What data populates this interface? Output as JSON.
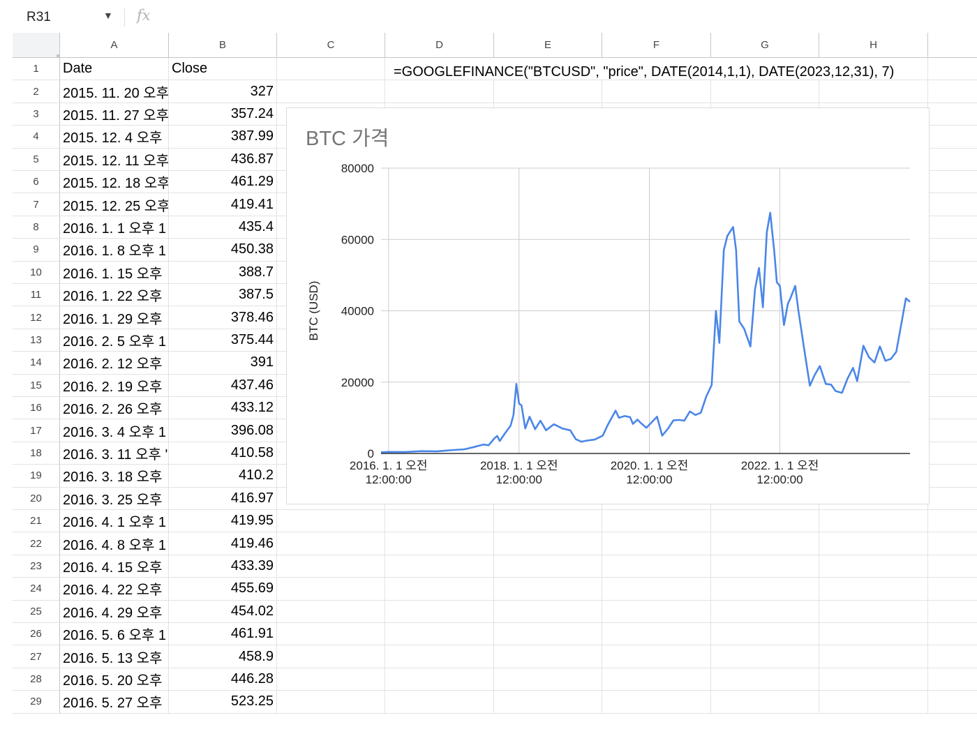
{
  "formula_bar": {
    "cell_ref": "R31",
    "fx_label": "fx"
  },
  "columns": [
    "A",
    "B",
    "C",
    "D",
    "E",
    "F",
    "G",
    "H"
  ],
  "rows": [
    {
      "num": "1",
      "date": "Date",
      "close": "Close"
    },
    {
      "num": "2",
      "date": "2015. 11. 20 오후",
      "close": "327"
    },
    {
      "num": "3",
      "date": "2015. 11. 27 오후",
      "close": "357.24"
    },
    {
      "num": "4",
      "date": "2015. 12. 4 오후",
      "close": "387.99"
    },
    {
      "num": "5",
      "date": "2015. 12. 11 오후",
      "close": "436.87"
    },
    {
      "num": "6",
      "date": "2015. 12. 18 오후",
      "close": "461.29"
    },
    {
      "num": "7",
      "date": "2015. 12. 25 오후",
      "close": "419.41"
    },
    {
      "num": "8",
      "date": "2016. 1. 1 오후 1",
      "close": "435.4"
    },
    {
      "num": "9",
      "date": "2016. 1. 8 오후 1",
      "close": "450.38"
    },
    {
      "num": "10",
      "date": "2016. 1. 15 오후",
      "close": "388.7"
    },
    {
      "num": "11",
      "date": "2016. 1. 22 오후",
      "close": "387.5"
    },
    {
      "num": "12",
      "date": "2016. 1. 29 오후",
      "close": "378.46"
    },
    {
      "num": "13",
      "date": "2016. 2. 5 오후 1",
      "close": "375.44"
    },
    {
      "num": "14",
      "date": "2016. 2. 12 오후",
      "close": "391"
    },
    {
      "num": "15",
      "date": "2016. 2. 19 오후",
      "close": "437.46"
    },
    {
      "num": "16",
      "date": "2016. 2. 26 오후",
      "close": "433.12"
    },
    {
      "num": "17",
      "date": "2016. 3. 4 오후 1",
      "close": "396.08"
    },
    {
      "num": "18",
      "date": "2016. 3. 11 오후 '",
      "close": "410.58"
    },
    {
      "num": "19",
      "date": "2016. 3. 18 오후",
      "close": "410.2"
    },
    {
      "num": "20",
      "date": "2016. 3. 25 오후",
      "close": "416.97"
    },
    {
      "num": "21",
      "date": "2016. 4. 1 오후 1",
      "close": "419.95"
    },
    {
      "num": "22",
      "date": "2016. 4. 8 오후 1",
      "close": "419.46"
    },
    {
      "num": "23",
      "date": "2016. 4. 15 오후",
      "close": "433.39"
    },
    {
      "num": "24",
      "date": "2016. 4. 22 오후",
      "close": "455.69"
    },
    {
      "num": "25",
      "date": "2016. 4. 29 오후",
      "close": "454.02"
    },
    {
      "num": "26",
      "date": "2016. 5. 6 오후 1",
      "close": "461.91"
    },
    {
      "num": "27",
      "date": "2016. 5. 13 오후",
      "close": "458.9"
    },
    {
      "num": "28",
      "date": "2016. 5. 20 오후",
      "close": "446.28"
    },
    {
      "num": "29",
      "date": "2016. 5. 27 오후",
      "close": "523.25"
    }
  ],
  "formula_cell": {
    "ref": "D1",
    "text": "=GOOGLEFINANCE(\"BTCUSD\", \"price\", DATE(2014,1,1), DATE(2023,12,31), 7)"
  },
  "chart_data": {
    "type": "line",
    "title": "BTC 가격",
    "xlabel": "",
    "ylabel": "BTC (USD)",
    "ylim": [
      0,
      80000
    ],
    "y_ticks": [
      "80000",
      "60000",
      "40000",
      "20000",
      "0"
    ],
    "x_ticks": [
      {
        "line1": "2016. 1. 1 오전",
        "line2": "12:00:00",
        "date": "2016-01-01"
      },
      {
        "line1": "2018. 1. 1 오전",
        "line2": "12:00:00",
        "date": "2018-01-01"
      },
      {
        "line1": "2020. 1. 1 오전",
        "line2": "12:00:00",
        "date": "2020-01-01"
      },
      {
        "line1": "2022. 1. 1 오전",
        "line2": "12:00:00",
        "date": "2022-01-01"
      }
    ],
    "xlim": [
      "2015-11-20",
      "2023-12-31"
    ],
    "grid": true,
    "line_color": "#4a86e8",
    "series": [
      {
        "x": [
          "2015-11-20",
          "2016-01-01",
          "2016-04-01",
          "2016-07-01",
          "2016-10-01",
          "2017-01-01",
          "2017-03-01",
          "2017-05-01",
          "2017-06-15",
          "2017-07-15",
          "2017-08-15",
          "2017-09-01",
          "2017-09-15",
          "2017-10-15",
          "2017-11-15",
          "2017-12-01",
          "2017-12-17",
          "2018-01-01",
          "2018-01-15",
          "2018-02-05",
          "2018-03-01",
          "2018-04-01",
          "2018-05-01",
          "2018-06-01",
          "2018-07-15",
          "2018-09-01",
          "2018-10-15",
          "2018-11-15",
          "2018-12-15",
          "2019-01-15",
          "2019-03-01",
          "2019-04-15",
          "2019-05-15",
          "2019-06-26",
          "2019-07-15",
          "2019-08-15",
          "2019-09-15",
          "2019-10-01",
          "2019-10-26",
          "2019-11-15",
          "2019-12-15",
          "2020-01-15",
          "2020-02-13",
          "2020-03-13",
          "2020-04-15",
          "2020-05-15",
          "2020-06-15",
          "2020-07-15",
          "2020-08-15",
          "2020-09-15",
          "2020-10-15",
          "2020-11-15",
          "2020-12-15",
          "2021-01-08",
          "2021-01-27",
          "2021-02-21",
          "2021-03-13",
          "2021-04-14",
          "2021-05-01",
          "2021-05-19",
          "2021-06-15",
          "2021-07-20",
          "2021-08-15",
          "2021-09-06",
          "2021-09-28",
          "2021-10-20",
          "2021-11-08",
          "2021-11-30",
          "2021-12-15",
          "2022-01-01",
          "2022-01-24",
          "2022-02-15",
          "2022-03-01",
          "2022-03-28",
          "2022-04-15",
          "2022-05-15",
          "2022-06-18",
          "2022-07-15",
          "2022-08-13",
          "2022-09-15",
          "2022-10-15",
          "2022-11-09",
          "2022-12-15",
          "2023-01-15",
          "2023-02-15",
          "2023-03-10",
          "2023-04-14",
          "2023-05-15",
          "2023-06-15",
          "2023-07-15",
          "2023-08-15",
          "2023-09-15",
          "2023-10-15",
          "2023-11-15",
          "2023-12-08",
          "2023-12-31"
        ],
        "y": [
          327,
          430,
          420,
          650,
          610,
          970,
          1180,
          1900,
          2500,
          2300,
          4200,
          4900,
          3500,
          5700,
          7800,
          10800,
          19500,
          14000,
          13500,
          7000,
          10300,
          6800,
          9200,
          6500,
          8200,
          7000,
          6500,
          4000,
          3300,
          3600,
          3900,
          5000,
          8200,
          12000,
          10000,
          10500,
          10200,
          8300,
          9500,
          8500,
          7200,
          8800,
          10300,
          5000,
          7000,
          9300,
          9400,
          9200,
          11800,
          10800,
          11400,
          16000,
          19200,
          40000,
          31000,
          57000,
          61000,
          63500,
          57000,
          37000,
          35000,
          30000,
          46000,
          52000,
          41000,
          62000,
          67500,
          57000,
          48000,
          47000,
          36000,
          42000,
          43500,
          47000,
          40000,
          30000,
          19000,
          22000,
          24500,
          19500,
          19300,
          17500,
          17000,
          21000,
          24000,
          20300,
          30200,
          27000,
          25500,
          30000,
          26000,
          26500,
          28500,
          37000,
          43500,
          42500
        ]
      }
    ]
  }
}
